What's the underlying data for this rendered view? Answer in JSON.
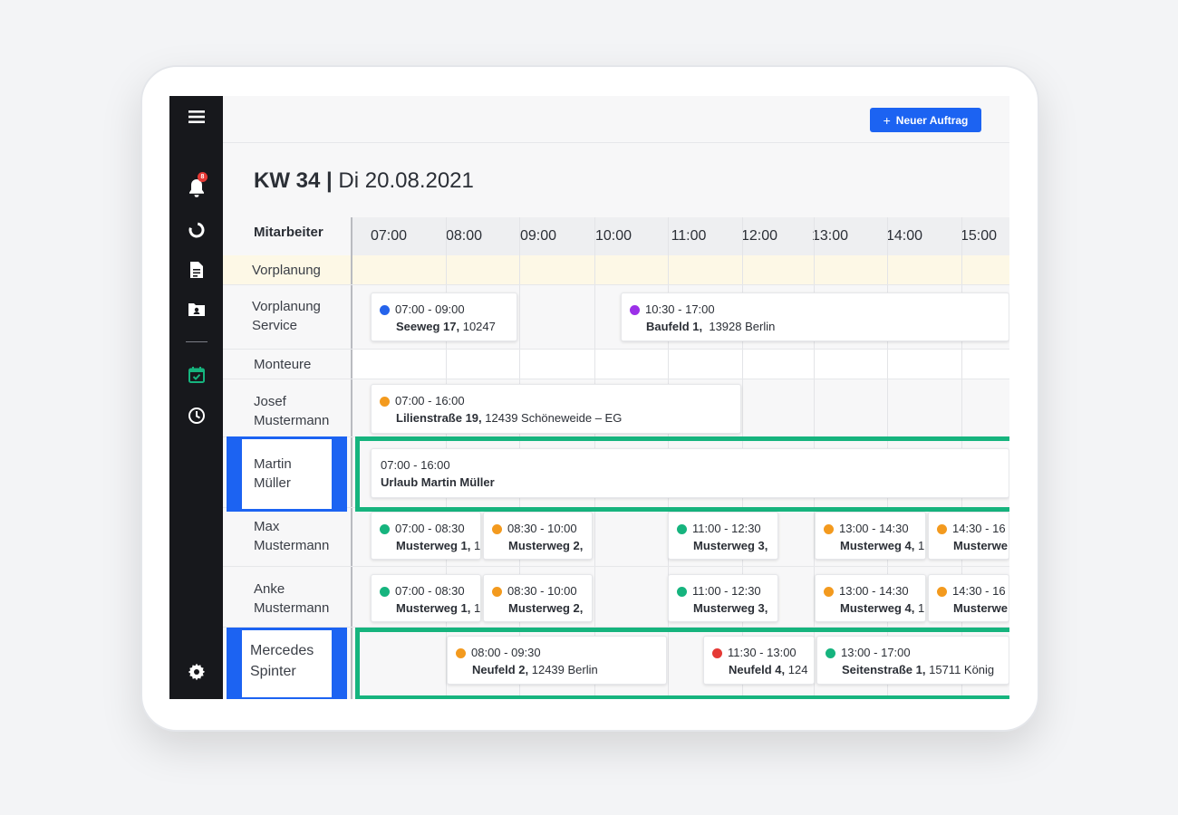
{
  "header": {
    "new_order_label": "Neuer Auftrag",
    "title_week": "KW 34",
    "title_sep": "|",
    "title_date": "Di 20.08.2021"
  },
  "sidebar": {
    "notification_count": "8",
    "items": [
      "menu-icon",
      "bell-icon",
      "donut-chart-icon",
      "document-icon",
      "contact-folder-icon",
      "calendar-check-icon",
      "clock-icon",
      "gear-icon"
    ]
  },
  "grid": {
    "column_header": "Mitarbeiter",
    "hours": [
      "07:00",
      "08:00",
      "09:00",
      "10:00",
      "11:00",
      "12:00",
      "13:00",
      "14:00",
      "15:00"
    ]
  },
  "rows": {
    "vorplanung": "Vorplanung",
    "vorplanung_service_1": "Vorplanung",
    "vorplanung_service_2": "Service",
    "monteure": "Monteure",
    "josef_1": "Josef",
    "josef_2": "Mustermann",
    "martin_1": "Martin",
    "martin_2": "Müller",
    "max_1": "Max",
    "max_2": "Mustermann",
    "anke_1": "Anke",
    "anke_2": "Mustermann",
    "mercedes_1": "Mercedes",
    "mercedes_2": "Spinter"
  },
  "events": {
    "e1": {
      "time": "07:00 - 09:00",
      "street": "Seeweg 17,",
      "rest": " 10247",
      "color": "#2563eb"
    },
    "e2": {
      "time": "10:30 - 17:00",
      "street": "Baufeld 1,",
      "rest": "  13928 Berlin",
      "color": "#9b30e8"
    },
    "e3": {
      "time": "07:00 - 16:00",
      "street": "Lilienstraße 19,",
      "rest": " 12439 Schöneweide – EG",
      "color": "#f39a1e"
    },
    "e4": {
      "time": "07:00 - 16:00",
      "street": "Urlaub Martin Müller",
      "rest": ""
    },
    "max1": {
      "time": "07:00 - 08:30",
      "street": "Musterweg 1,",
      "rest": " 1",
      "color": "#16b47e"
    },
    "max2": {
      "time": "08:30 - 10:00",
      "street": "Musterweg 2,",
      "rest": "",
      "color": "#f39a1e"
    },
    "max3": {
      "time": "11:00 - 12:30",
      "street": "Musterweg 3,",
      "rest": "",
      "color": "#16b47e"
    },
    "max4": {
      "time": "13:00 - 14:30",
      "street": "Musterweg 4,",
      "rest": " 1",
      "color": "#f39a1e"
    },
    "max5": {
      "time": "14:30 - 16",
      "street": "Musterwe",
      "rest": "",
      "color": "#f39a1e"
    },
    "anke1": {
      "time": "07:00 - 08:30",
      "street": "Musterweg 1,",
      "rest": " 1",
      "color": "#16b47e"
    },
    "anke2": {
      "time": "08:30 - 10:00",
      "street": "Musterweg 2,",
      "rest": "",
      "color": "#f39a1e"
    },
    "anke3": {
      "time": "11:00 - 12:30",
      "street": "Musterweg 3,",
      "rest": "",
      "color": "#16b47e"
    },
    "anke4": {
      "time": "13:00 - 14:30",
      "street": "Musterweg 4,",
      "rest": " 1",
      "color": "#f39a1e"
    },
    "anke5": {
      "time": "14:30 - 16",
      "street": "Musterwe",
      "rest": "",
      "color": "#f39a1e"
    },
    "merc1": {
      "time": "08:00 - 09:30",
      "street": "Neufeld 2,",
      "rest": " 12439 Berlin",
      "color": "#f39a1e"
    },
    "merc2": {
      "time": "11:30 - 13:00",
      "street": "Neufeld 4,",
      "rest": " 124",
      "color": "#e53935"
    },
    "merc3": {
      "time": "13:00 - 17:00",
      "street": "Seitenstraße 1,",
      "rest": " 15711 König",
      "color": "#16b47e"
    }
  },
  "colors": {
    "accent_blue": "#1c63f2",
    "highlight_green": "#16b47e",
    "sidebar_bg": "#17181c",
    "active_icon": "#16b47e"
  }
}
